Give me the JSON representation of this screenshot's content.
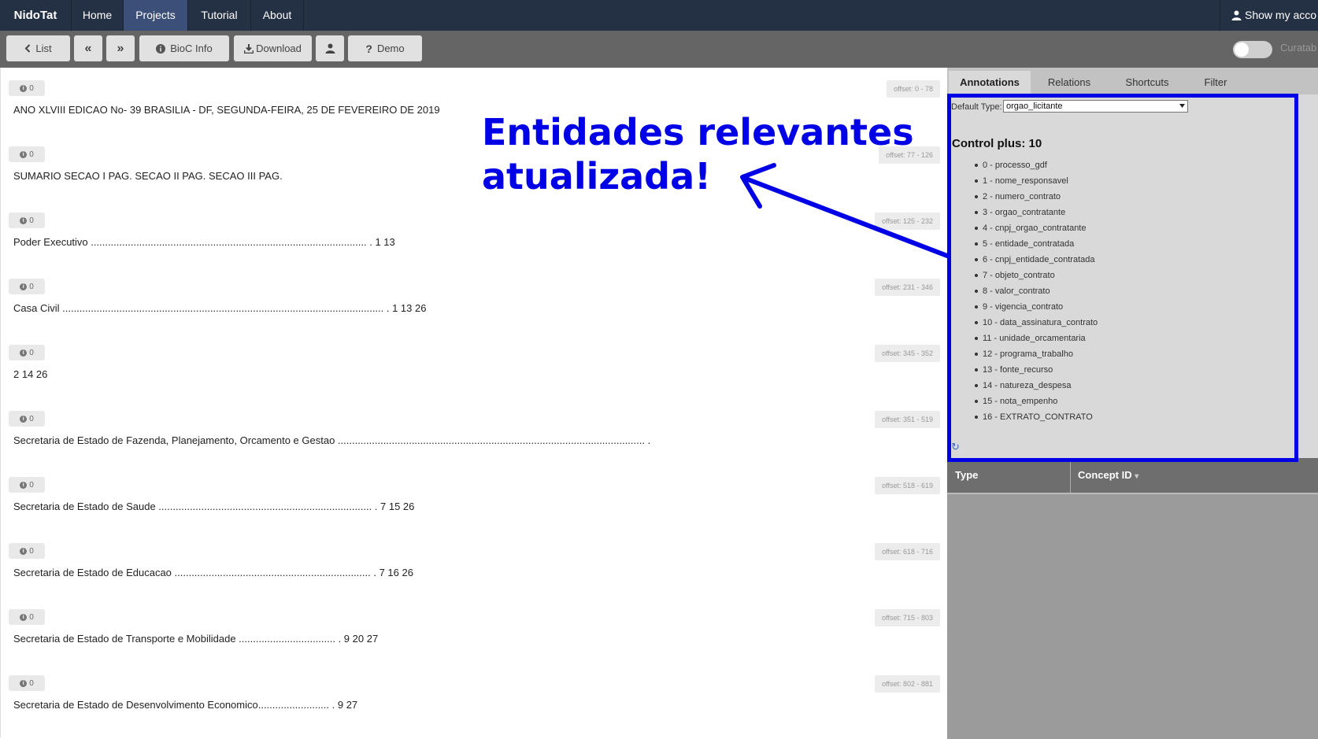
{
  "nav": {
    "brand": "NidoTat",
    "items": [
      {
        "label": "Home"
      },
      {
        "label": "Projects",
        "active": true
      },
      {
        "label": "Tutorial"
      },
      {
        "label": "About"
      }
    ],
    "account": "Show my acco"
  },
  "toolbar": {
    "list": "List",
    "prev": "«",
    "next": "»",
    "bioc": "BioC Info",
    "download": "Download",
    "demo": "Demo",
    "toggle_label": "Curatab"
  },
  "passages": [
    {
      "count": "0",
      "offset": "offset: 0 - 78",
      "text": "ANO XLVIII EDICAO No- 39 BRASILIA - DF, SEGUNDA-FEIRA, 25 DE FEVEREIRO DE 2019"
    },
    {
      "count": "0",
      "offset": "offset: 77 - 126",
      "text": "SUMARIO SECAO I PAG. SECAO II PAG. SECAO III PAG."
    },
    {
      "count": "0",
      "offset": "offset: 125 - 232",
      "text": "Poder Executivo ................................................................................................. . 1 13"
    },
    {
      "count": "0",
      "offset": "offset: 231 - 346",
      "text": "Casa Civil ................................................................................................................. . 1 13 26"
    },
    {
      "count": "0",
      "offset": "offset: 345 - 352",
      "text": "2 14 26"
    },
    {
      "count": "0",
      "offset": "offset: 351 - 519",
      "text": "Secretaria de Estado de Fazenda, Planejamento, Orcamento e Gestao ............................................................................................................ ."
    },
    {
      "count": "0",
      "offset": "offset: 518 - 619",
      "text": "Secretaria de Estado de Saude ........................................................................... . 7 15 26"
    },
    {
      "count": "0",
      "offset": "offset: 618 - 716",
      "text": "Secretaria de Estado de Educacao ..................................................................... . 7 16 26"
    },
    {
      "count": "0",
      "offset": "offset: 715 - 803",
      "text": "Secretaria de Estado de Transporte e Mobilidade .................................. . 9 20 27"
    },
    {
      "count": "0",
      "offset": "offset: 802 - 881",
      "text": "Secretaria de Estado de Desenvolvimento Economico......................... . 9 27"
    }
  ],
  "right": {
    "tabs": [
      {
        "label": "Annotations",
        "active": true
      },
      {
        "label": "Relations"
      },
      {
        "label": "Shortcuts"
      },
      {
        "label": "Filter"
      }
    ],
    "default_type_label": "Default Type:",
    "default_type_value": "orgao_licitante",
    "control_heading": "Control plus: 10",
    "entities": [
      "0 - processo_gdf",
      "1 - nome_responsavel",
      "2 - numero_contrato",
      "3 - orgao_contratante",
      "4 - cnpj_orgao_contratante",
      "5 - entidade_contratada",
      "6 - cnpj_entidade_contratada",
      "7 - objeto_contrato",
      "8 - valor_contrato",
      "9 - vigencia_contrato",
      "10 - data_assinatura_contrato",
      "11 - unidade_orcamentaria",
      "12 - programa_trabalho",
      "13 - fonte_recurso",
      "14 - natureza_despesa",
      "15 - nota_empenho",
      "16 - EXTRATO_CONTRATO"
    ],
    "table_headers": {
      "type": "Type",
      "concept_id": "Concept ID"
    }
  },
  "callout": {
    "line1": "Entidades relevantes",
    "line2": "atualizada!",
    "color": "#0000e6"
  }
}
